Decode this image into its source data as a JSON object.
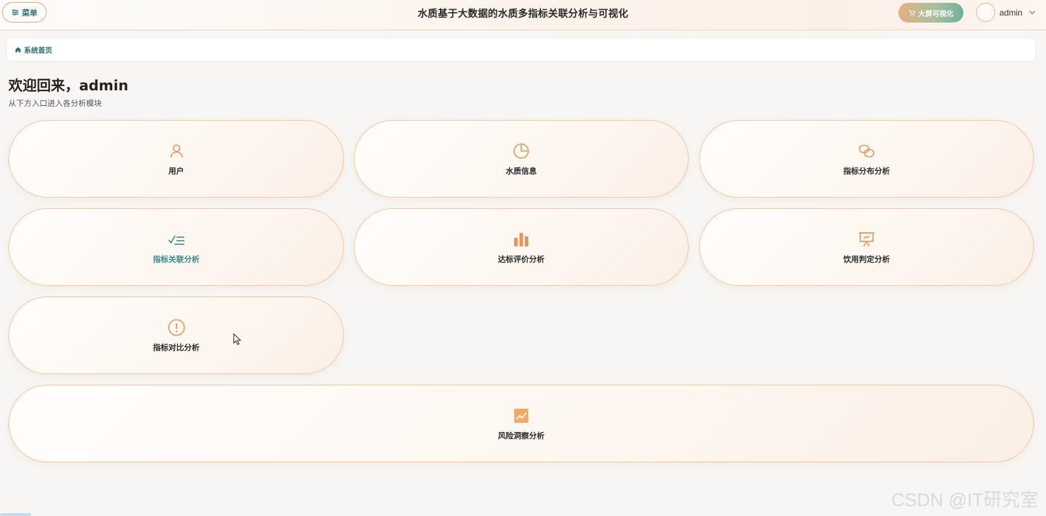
{
  "header": {
    "menu_label": "菜单",
    "title": "水质基于大数据的水质多指标关联分析与可视化",
    "bigscreen_label": "大屏可视化",
    "user_name": "admin"
  },
  "breadcrumb": {
    "home": "系统首页"
  },
  "welcome": {
    "title": "欢迎回来，admin",
    "subtitle": "从下方入口进入各分析模块"
  },
  "cards": [
    {
      "label": "用户",
      "icon": "user-icon"
    },
    {
      "label": "水质信息",
      "icon": "pie-chart-icon"
    },
    {
      "label": "指标分布分析",
      "icon": "link-icon"
    },
    {
      "label": "指标关联分析",
      "icon": "checklist-icon",
      "active": true
    },
    {
      "label": "达标评价分析",
      "icon": "bar-chart-icon"
    },
    {
      "label": "饮用判定分析",
      "icon": "presentation-icon"
    },
    {
      "label": "指标对比分析",
      "icon": "warning-circle-icon"
    },
    {
      "label": "风险洞察分析",
      "icon": "trend-chart-icon"
    }
  ],
  "colors": {
    "accent_teal": "#3a8a85",
    "icon_orange": "#e8955a",
    "card_border": "#f1c7a5"
  },
  "watermark": "CSDN @IT研究室"
}
